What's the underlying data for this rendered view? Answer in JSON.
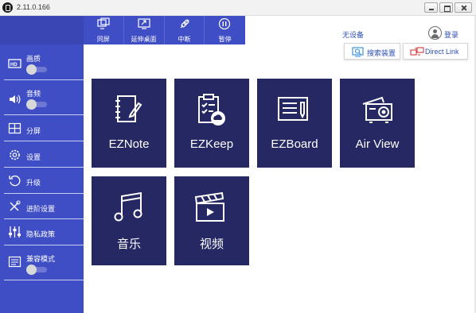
{
  "window": {
    "title": "2.11.0.166"
  },
  "toolbar": {
    "buttons": [
      {
        "label": "同屏",
        "icon": "mirror-screen-icon"
      },
      {
        "label": "延伸桌面",
        "icon": "extend-desktop-icon"
      },
      {
        "label": "中断",
        "icon": "disconnect-icon"
      },
      {
        "label": "暂停",
        "icon": "pause-icon"
      }
    ]
  },
  "sidebar": {
    "items": [
      {
        "label": "画质",
        "icon": "hd-icon",
        "toggle": false
      },
      {
        "label": "音频",
        "icon": "speaker-icon",
        "toggle": false
      },
      {
        "label": "分屏",
        "icon": "split-screen-icon"
      },
      {
        "label": "设置",
        "icon": "gear-icon"
      },
      {
        "label": "升级",
        "icon": "update-icon"
      },
      {
        "label": "进阶设置",
        "icon": "advanced-tools-icon"
      },
      {
        "label": "隐私政策",
        "icon": "sliders-icon"
      },
      {
        "label": "兼容模式",
        "icon": "compatibility-icon",
        "toggle": false
      }
    ]
  },
  "header": {
    "device_status": "无设备",
    "login_label": "登录",
    "search_label": "搜索装置",
    "direct_link_label": "Direct Link"
  },
  "tiles": [
    {
      "label": "EZNote",
      "icon": "notebook-pen-icon"
    },
    {
      "label": "EZKeep",
      "icon": "clipboard-cloud-icon"
    },
    {
      "label": "EZBoard",
      "icon": "whiteboard-icon"
    },
    {
      "label": "Air View",
      "icon": "projector-icon"
    },
    {
      "label": "音乐",
      "icon": "music-note-icon"
    },
    {
      "label": "视频",
      "icon": "clapperboard-icon"
    }
  ],
  "colors": {
    "sidebar_bg": "#3f4ec4",
    "tile_bg": "#252863",
    "link_text": "#2d4fb4"
  }
}
